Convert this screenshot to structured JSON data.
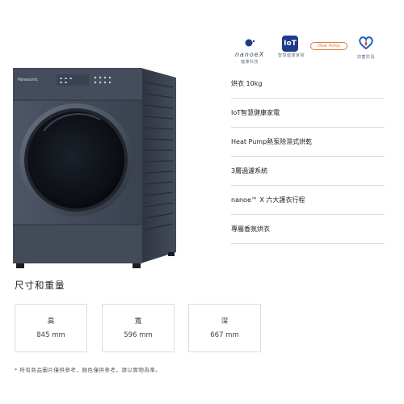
{
  "badges": {
    "nanoe_word": "nanoeX",
    "nanoe_caption": "健康科技",
    "iot_word": "IoT",
    "iot_caption": "智慧健康家電",
    "heat_pump_word": "Heat Pump",
    "heart_caption": "抑菌防臭"
  },
  "product": {
    "brand": "Panasonic"
  },
  "features": [
    "烘衣 10kg",
    "IoT智慧健康家電",
    "Heat Pump熱泵除濕式烘乾",
    "3層過濾系統",
    "nanoe™ X 六大護衣行程",
    "專屬香氛烘衣"
  ],
  "dimensions": {
    "title": "尺寸和重量",
    "items": [
      {
        "label": "高",
        "value": "845 mm"
      },
      {
        "label": "寬",
        "value": "596 mm"
      },
      {
        "label": "深",
        "value": "667 mm"
      }
    ]
  },
  "note": "* 所有商品圖片僅供參考，顏色僅供參考，請以實物為準。",
  "colors": {
    "machine_body": "#3f4756",
    "door_glass": "#0f1218",
    "accent_blue": "#1f3b8a",
    "accent_orange": "#e07a3a"
  }
}
